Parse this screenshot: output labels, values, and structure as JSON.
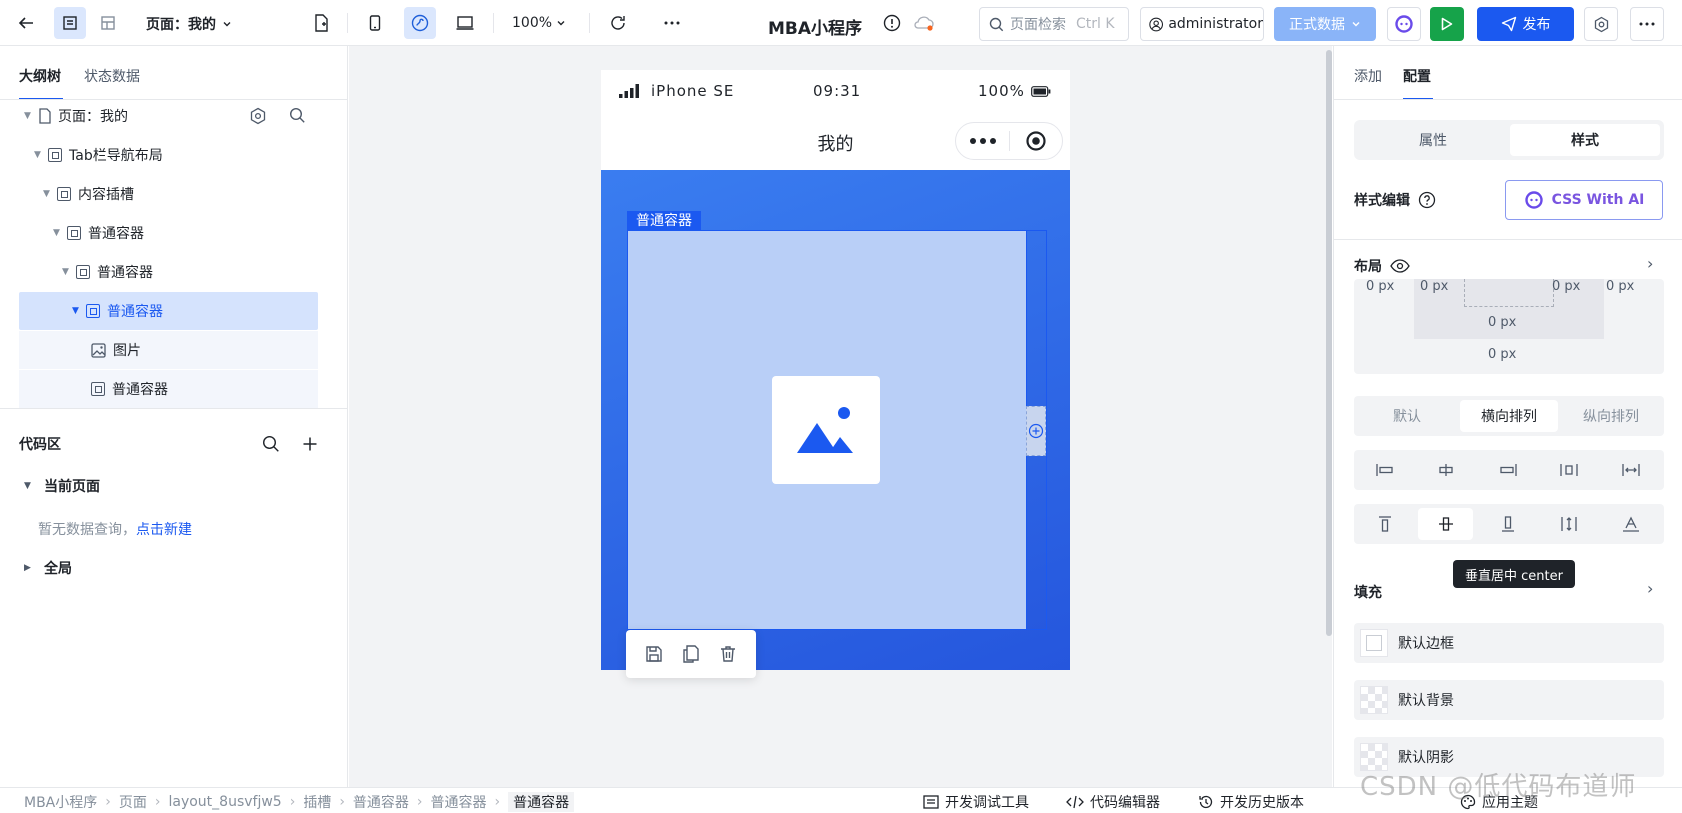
{
  "topbar": {
    "page_selector": "页面：我的",
    "zoom": "100%",
    "app_title": "MBA小程序",
    "search_placeholder": "页面检索",
    "search_shortcut": "Ctrl K",
    "user": "administrator",
    "env": "正式数据",
    "publish": "发布"
  },
  "left": {
    "tabs": [
      "大纲树",
      "状态数据"
    ],
    "tree": [
      {
        "label": "页面：我的",
        "depth": 0,
        "icon": "page-icon"
      },
      {
        "label": "Tab栏导航布局",
        "depth": 1,
        "icon": "node-icon"
      },
      {
        "label": "内容插槽",
        "depth": 2,
        "icon": "node-icon"
      },
      {
        "label": "普通容器",
        "depth": 3,
        "icon": "node-icon"
      },
      {
        "label": "普通容器",
        "depth": 4,
        "icon": "node-icon"
      },
      {
        "label": "普通容器",
        "depth": 5,
        "icon": "node-icon",
        "selected": true
      },
      {
        "label": "图片",
        "depth": 6,
        "icon": "image-icon"
      },
      {
        "label": "普通容器",
        "depth": 6,
        "icon": "node-icon"
      }
    ],
    "code": {
      "title": "代码区",
      "current_page": "当前页面",
      "empty_text": "暂无数据查询，",
      "empty_link": "点击新建",
      "global": "全局"
    }
  },
  "phone": {
    "device": "iPhone SE",
    "time": "09:31",
    "battery": "100%",
    "nav_title": "我的",
    "selected_label": "普通容器"
  },
  "right": {
    "tabs": [
      "添加",
      "配置"
    ],
    "segment": [
      "属性",
      "样式"
    ],
    "style_edit": "样式编辑",
    "css_ai": "CSS With AI",
    "layout": "布局",
    "box_values": {
      "outer_left": "0 px",
      "inner_left": "0 px",
      "inner_right": "0 px",
      "outer_right": "0 px",
      "inner_bottom": "0 px",
      "outer_bottom": "0 px"
    },
    "direction": [
      "默认",
      "横向排列",
      "纵向排列"
    ],
    "tooltip": "垂直居中 center",
    "fill": "填充",
    "fill_items": [
      "默认边框",
      "默认背景",
      "默认阴影"
    ]
  },
  "bottom": {
    "breadcrumb": [
      "MBA小程序",
      "页面",
      "layout_8usvfjw5",
      "插槽",
      "普通容器",
      "普通容器",
      "普通容器"
    ],
    "tools": [
      "开发调试工具",
      "代码编辑器",
      "开发历史版本"
    ],
    "theme": "应用主题"
  },
  "watermark": "CSDN @低代码布道师",
  "colors": {
    "primary": "#1b59f0",
    "canvas_bg": "#f2f3f5",
    "run": "#16a34a",
    "env": "#8ab4f8"
  }
}
